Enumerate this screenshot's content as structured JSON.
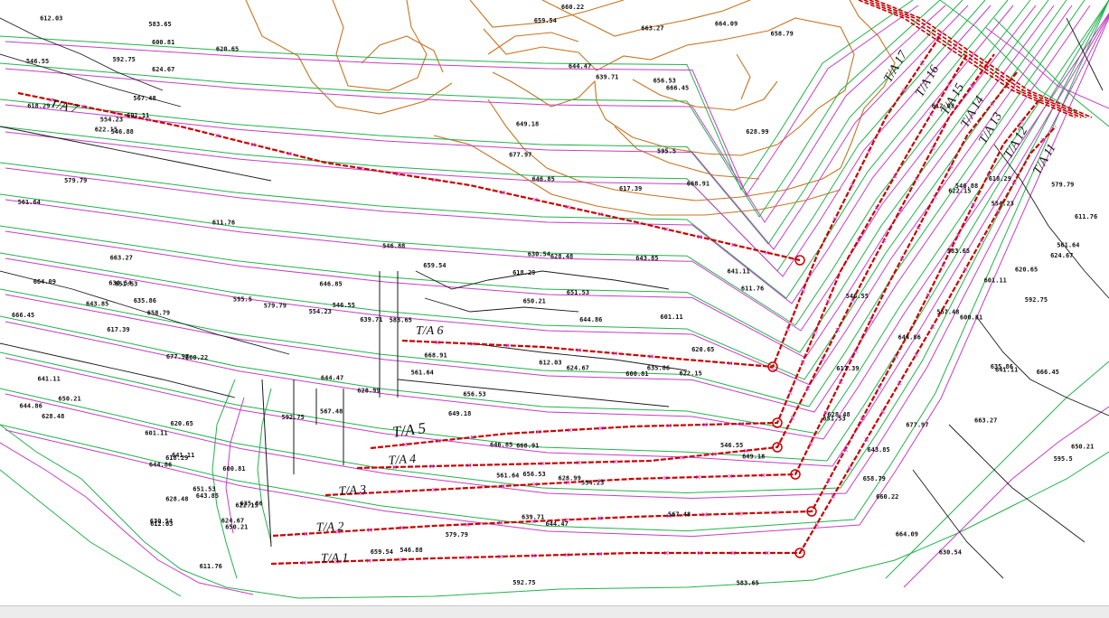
{
  "colors": {
    "contour_green": "#22b24c",
    "contour_magenta": "#c83cc8",
    "contour_orange": "#c8741e",
    "contour_black": "#1a1a1a",
    "survey_line": "#cc0000",
    "marker": "#d43cd4",
    "background": "#ffffff"
  },
  "survey_lines": [
    {
      "label": "T/A 7"
    },
    {
      "label": "T/A 6"
    },
    {
      "label": "T/A 5"
    },
    {
      "label": "T/A 4"
    },
    {
      "label": "T/A 3"
    },
    {
      "label": "T/A 2"
    },
    {
      "label": "T/A 1"
    },
    {
      "label": "T/A 17"
    },
    {
      "label": "T/A 16"
    },
    {
      "label": "T/A 15"
    },
    {
      "label": "T/A 14"
    },
    {
      "label": "T/A 13"
    },
    {
      "label": "T/A 12"
    },
    {
      "label": "T/A 11"
    }
  ],
  "elevations": [
    "546.88",
    "546.55",
    "554.23",
    "561.64",
    "567.48",
    "579.79",
    "583.65",
    "592.75",
    "600.81",
    "601.11",
    "612.03",
    "611.76",
    "618.29",
    "620.65",
    "622.15",
    "624.67",
    "628.48",
    "630.54",
    "635.86",
    "641.11",
    "643.85",
    "644.86",
    "650.21",
    "651.53",
    "658.79",
    "660.22",
    "664.09",
    "663.27",
    "666.45",
    "677.97",
    "595.5",
    "617.39",
    "628.99",
    "639.71",
    "646.85",
    "659.54",
    "644.47",
    "649.18",
    "656.53",
    "668.91"
  ]
}
